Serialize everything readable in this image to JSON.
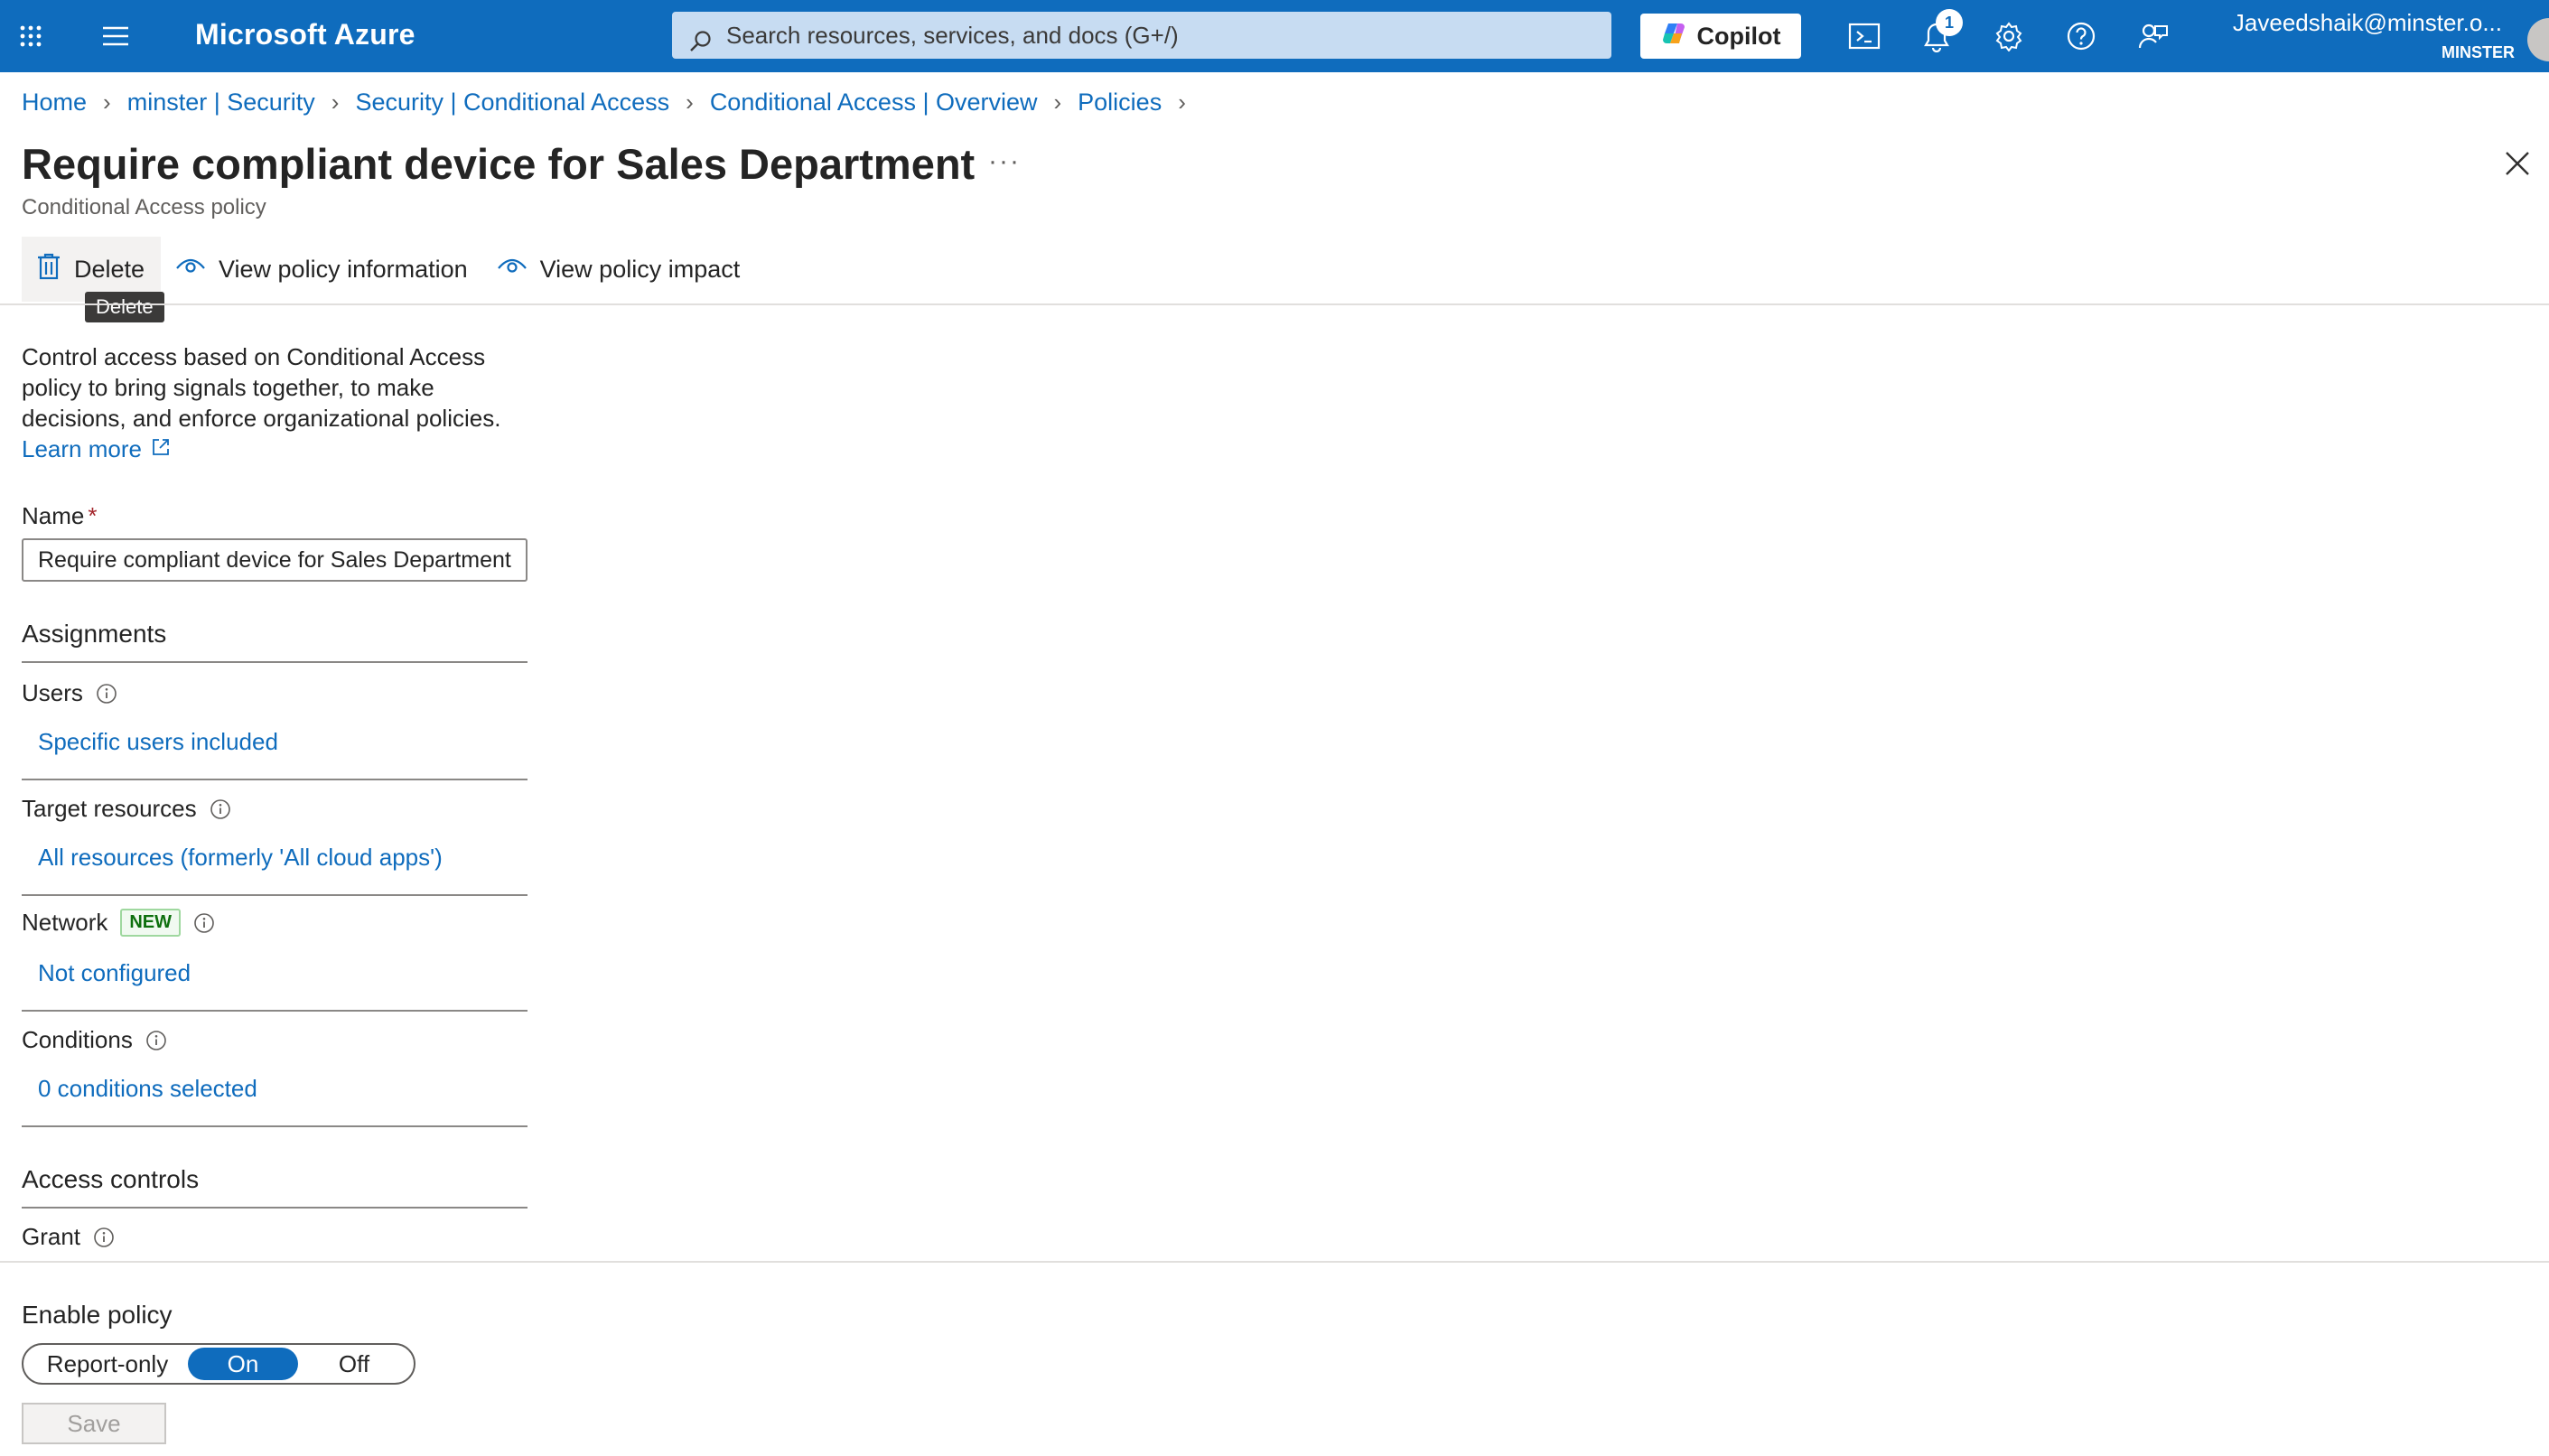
{
  "topbar": {
    "brand": "Microsoft Azure",
    "search_placeholder": "Search resources, services, and docs (G+/)",
    "copilot_label": "Copilot",
    "notification_count": "1",
    "account_name": "Javeedshaik@minster.o...",
    "account_org": "MINSTER",
    "colors": {
      "bar": "#0f6cbd"
    }
  },
  "breadcrumb": [
    "Home",
    "minster | Security",
    "Security | Conditional Access",
    "Conditional Access | Overview",
    "Policies"
  ],
  "page": {
    "title": "Require compliant device for Sales Department",
    "more": "···",
    "subtitle": "Conditional Access policy"
  },
  "toolbar": {
    "delete_label": "Delete",
    "delete_tooltip": "Delete",
    "view_info_label": "View policy information",
    "view_impact_label": "View policy impact"
  },
  "description": {
    "text": "Control access based on Conditional Access policy to bring signals together, to make decisions, and enforce organizational policies.",
    "learn_more": "Learn more"
  },
  "name_field": {
    "label": "Name",
    "required_mark": "*",
    "value": "Require compliant device for Sales Department"
  },
  "assignments": {
    "heading": "Assignments",
    "users": {
      "label": "Users",
      "value": "Specific users included"
    },
    "target_resources": {
      "label": "Target resources",
      "value": "All resources (formerly 'All cloud apps')"
    },
    "network": {
      "label": "Network",
      "tag": "NEW",
      "value": "Not configured"
    },
    "conditions": {
      "label": "Conditions",
      "value": "0 conditions selected"
    }
  },
  "access_controls": {
    "heading": "Access controls",
    "grant": {
      "label": "Grant"
    }
  },
  "enable_policy": {
    "label": "Enable policy",
    "options": [
      "Report-only",
      "On",
      "Off"
    ],
    "selected": "On"
  },
  "save_label": "Save"
}
